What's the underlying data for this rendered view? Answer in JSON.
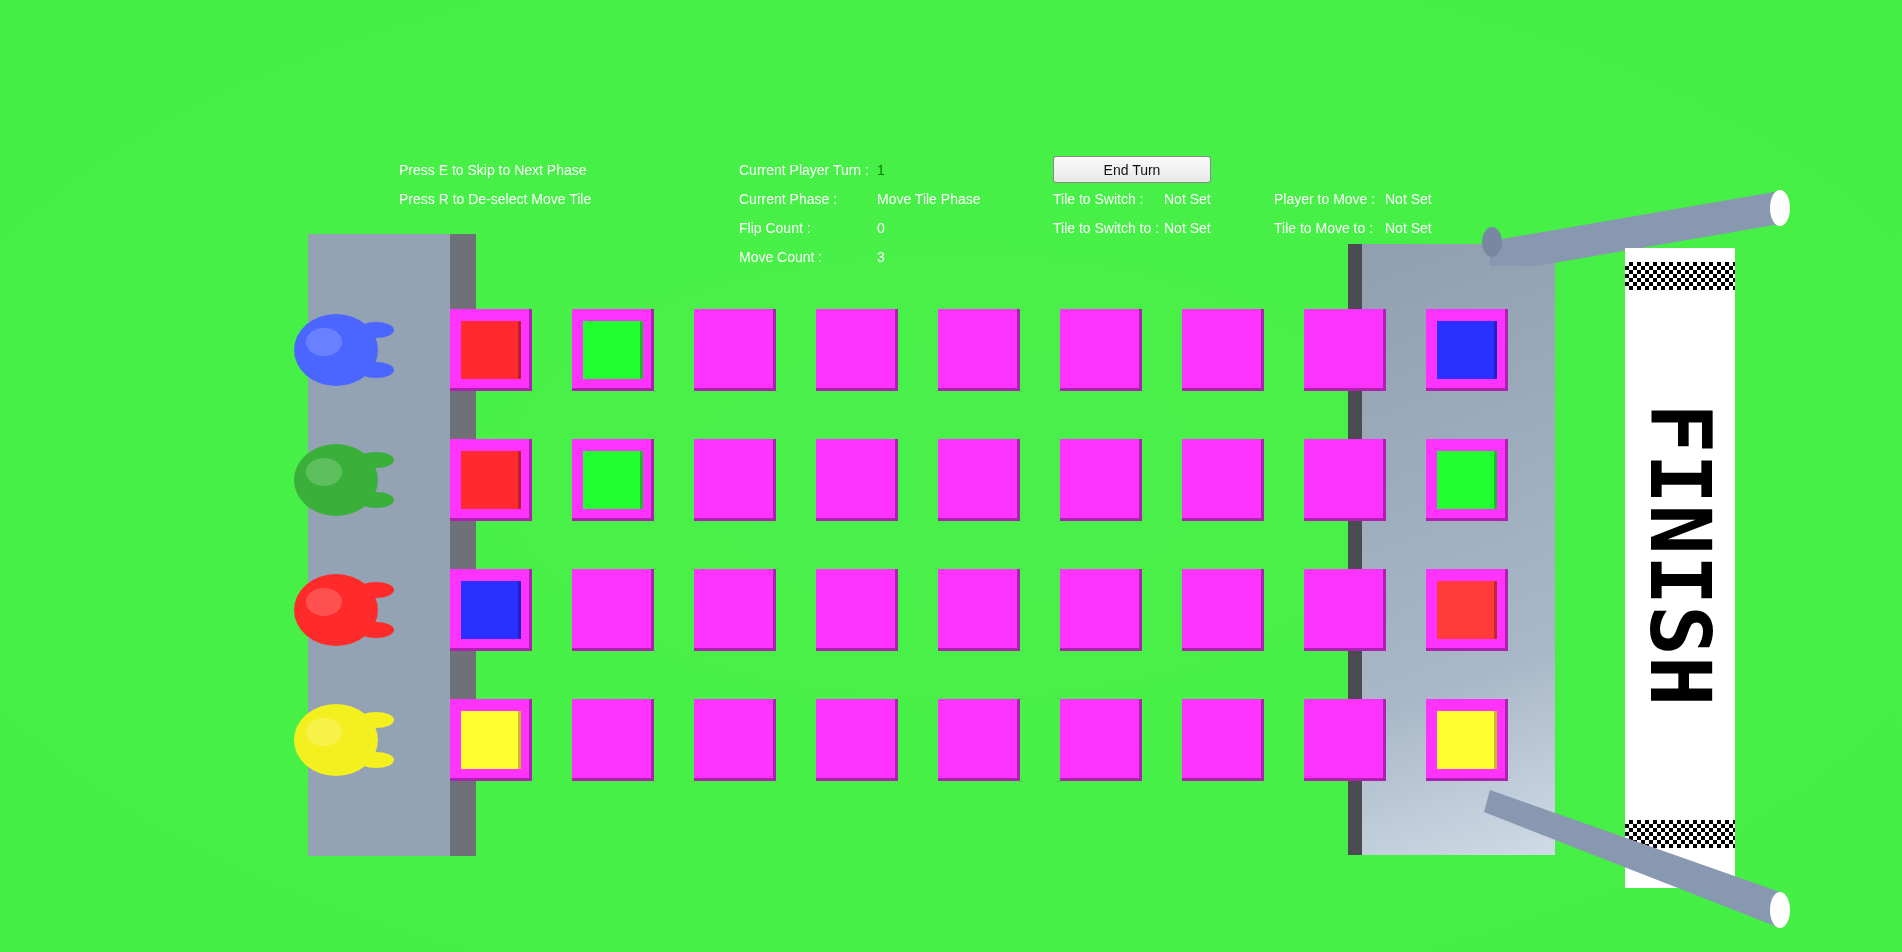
{
  "instructions": [
    "Press E to Skip to Next Phase",
    "Press R to De-select Move Tile"
  ],
  "status": [
    {
      "label": "Current Player Turn :",
      "value": "1",
      "color": "#0b7a0b"
    },
    {
      "label": "Current Phase :",
      "value": "Move Tile Phase",
      "color": "#ffffff"
    },
    {
      "label": "Flip Count :",
      "value": "0",
      "color": "#ffffff"
    },
    {
      "label": "Move Count :",
      "value": "3",
      "color": "#ffffff"
    }
  ],
  "end_turn_button": "End Turn",
  "switch_info": [
    {
      "label": "Tile to Switch :",
      "value": "Not Set"
    },
    {
      "label": "Tile to Switch to :",
      "value": "Not Set"
    }
  ],
  "move_info": [
    {
      "label": "Player to Move :",
      "value": "Not Set"
    },
    {
      "label": "Tile to Move to :",
      "value": "Not Set"
    }
  ],
  "board": {
    "rows": [
      {
        "player": {
          "color": "#4a66ff"
        },
        "tiles": [
          {
            "kind": "framed",
            "color": "#ff2a30"
          },
          {
            "kind": "framed",
            "color": "#22ff30"
          },
          {
            "kind": "plain"
          },
          {
            "kind": "plain"
          },
          {
            "kind": "plain"
          },
          {
            "kind": "plain"
          },
          {
            "kind": "plain"
          },
          {
            "kind": "plain"
          },
          {
            "kind": "framed",
            "color": "#2a30ff"
          }
        ]
      },
      {
        "player": {
          "color": "#3ab03a"
        },
        "tiles": [
          {
            "kind": "framed",
            "color": "#ff2a30"
          },
          {
            "kind": "framed",
            "color": "#22ff30"
          },
          {
            "kind": "plain"
          },
          {
            "kind": "plain"
          },
          {
            "kind": "plain"
          },
          {
            "kind": "plain"
          },
          {
            "kind": "plain"
          },
          {
            "kind": "plain"
          },
          {
            "kind": "framed",
            "color": "#22ff30"
          }
        ]
      },
      {
        "player": {
          "color": "#ff2a2a"
        },
        "tiles": [
          {
            "kind": "framed",
            "color": "#2a30ff"
          },
          {
            "kind": "plain"
          },
          {
            "kind": "plain"
          },
          {
            "kind": "plain"
          },
          {
            "kind": "plain"
          },
          {
            "kind": "plain"
          },
          {
            "kind": "plain"
          },
          {
            "kind": "plain"
          },
          {
            "kind": "framed",
            "color": "#ff3a3a"
          }
        ]
      },
      {
        "player": {
          "color": "#f4f020"
        },
        "tiles": [
          {
            "kind": "framed",
            "color": "#ffff30"
          },
          {
            "kind": "plain"
          },
          {
            "kind": "plain"
          },
          {
            "kind": "plain"
          },
          {
            "kind": "plain"
          },
          {
            "kind": "plain"
          },
          {
            "kind": "plain"
          },
          {
            "kind": "plain"
          },
          {
            "kind": "framed",
            "color": "#ffff30"
          }
        ]
      }
    ]
  },
  "finish_banner": "FINISH"
}
